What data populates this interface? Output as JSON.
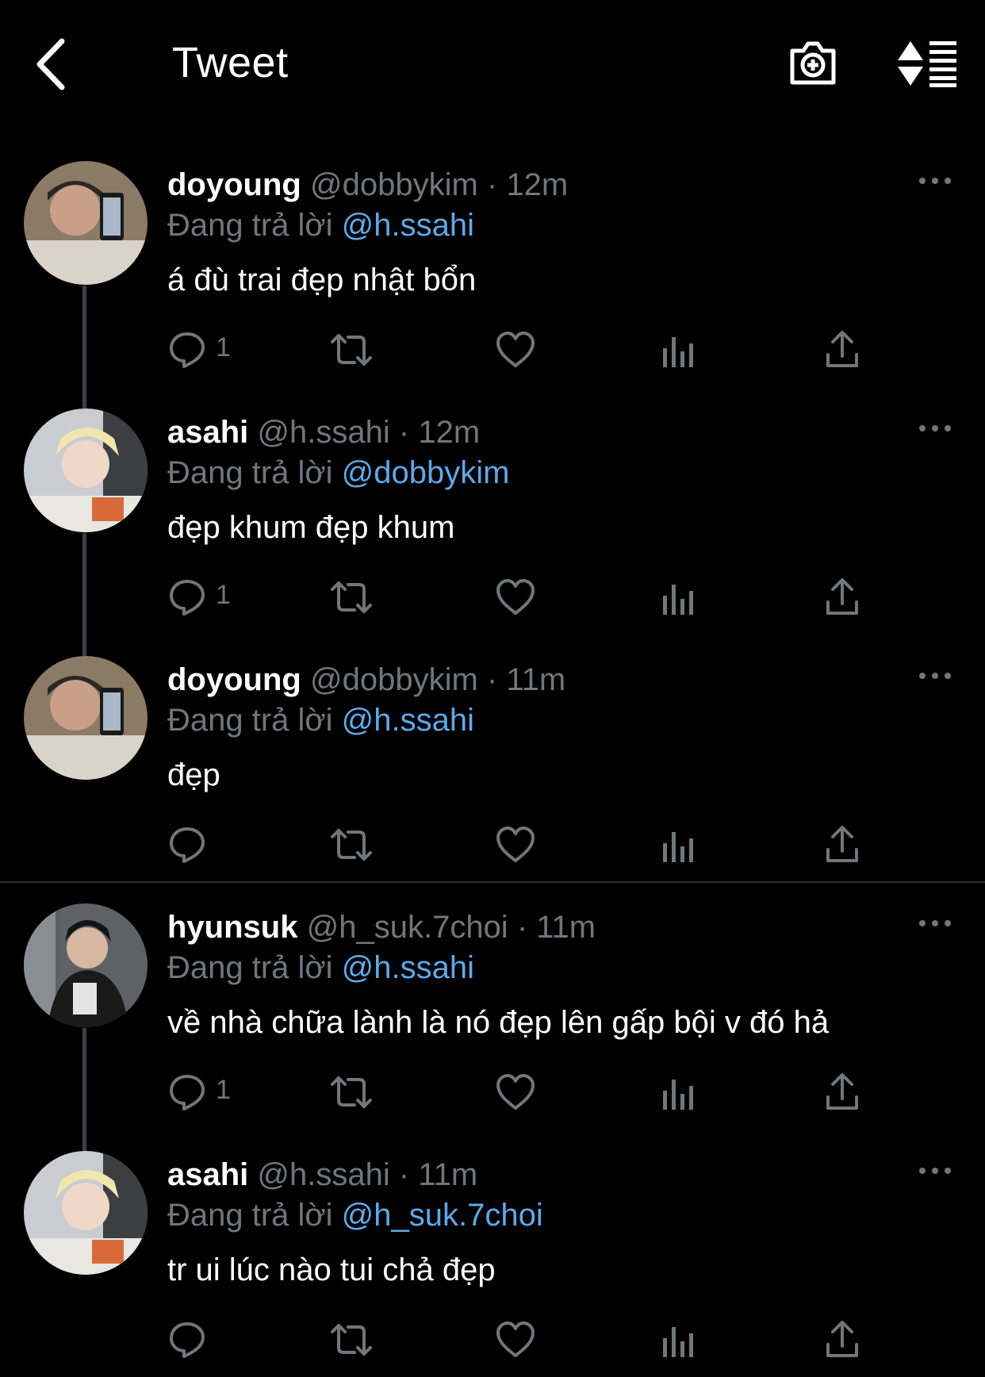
{
  "header": {
    "title": "Tweet"
  },
  "tweets": [
    {
      "name": "doyoung",
      "handle": "@dobbykim",
      "time": "12m",
      "replying_prefix": "Đang trả lời",
      "replying_to": "@h.ssahi",
      "text": "á đù trai đẹp nhật bổn",
      "reply_count": "1"
    },
    {
      "name": "asahi",
      "handle": "@h.ssahi",
      "time": "12m",
      "replying_prefix": "Đang trả lời",
      "replying_to": "@dobbykim",
      "text": "đẹp khum đẹp khum",
      "reply_count": "1"
    },
    {
      "name": "doyoung",
      "handle": "@dobbykim",
      "time": "11m",
      "replying_prefix": "Đang trả lời",
      "replying_to": "@h.ssahi",
      "text": "đẹp",
      "reply_count": ""
    },
    {
      "name": "hyunsuk",
      "handle": "@h_suk.7choi",
      "time": "11m",
      "replying_prefix": "Đang trả lời",
      "replying_to": "@h.ssahi",
      "text": "về nhà chữa lành là nó đẹp lên gấp bội v đó hả",
      "reply_count": "1"
    },
    {
      "name": "asahi",
      "handle": "@h.ssahi",
      "time": "11m",
      "replying_prefix": "Đang trả lời",
      "replying_to": "@h_suk.7choi",
      "text": "tr ui lúc nào tui chả đẹp",
      "reply_count": ""
    }
  ],
  "separator": "·",
  "icons": {
    "back": "chevron-left-icon",
    "camera": "camera-add-icon",
    "sort": "sort-list-icon",
    "more": "more-horizontal-icon",
    "reply": "reply-icon",
    "retweet": "retweet-icon",
    "like": "heart-icon",
    "analytics": "analytics-icon",
    "share": "share-icon"
  },
  "colors": {
    "background": "#000000",
    "text": "#ffffff",
    "muted": "#71767b",
    "mention": "#5fa8e8",
    "thread_line": "#3a3f44"
  }
}
